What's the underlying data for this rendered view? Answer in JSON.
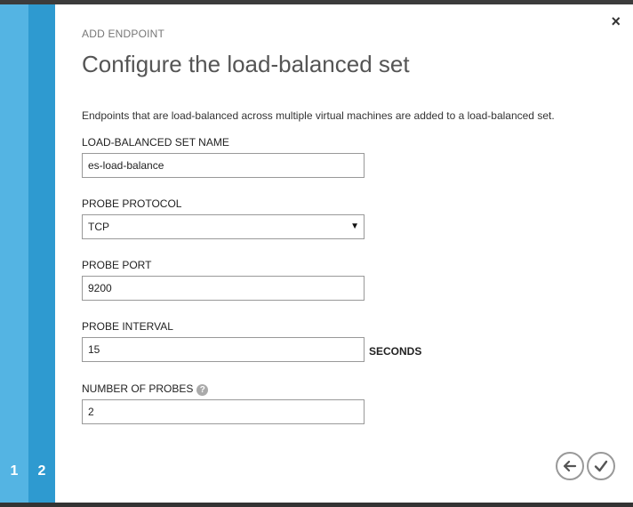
{
  "steps": [
    "1",
    "2"
  ],
  "dialog": {
    "eyebrow": "ADD ENDPOINT",
    "title": "Configure the load-balanced set",
    "description": "Endpoints that are load-balanced across multiple virtual machines are added to a load-balanced set.",
    "close_glyph": "×"
  },
  "fields": {
    "set_name": {
      "label": "LOAD-BALANCED SET NAME",
      "value": "es-load-balance"
    },
    "probe_protocol": {
      "label": "PROBE PROTOCOL",
      "value": "TCP"
    },
    "probe_port": {
      "label": "PROBE PORT",
      "value": "9200"
    },
    "probe_interval": {
      "label": "PROBE INTERVAL",
      "value": "15",
      "suffix": "SECONDS"
    },
    "number_of_probes": {
      "label": "NUMBER OF PROBES",
      "value": "2"
    }
  },
  "icons": {
    "help": "?",
    "back": "back-arrow-icon",
    "confirm": "checkmark-icon",
    "dropdown": "▼"
  },
  "colors": {
    "step1": "#54b4e3",
    "step2": "#2e9ad0"
  }
}
